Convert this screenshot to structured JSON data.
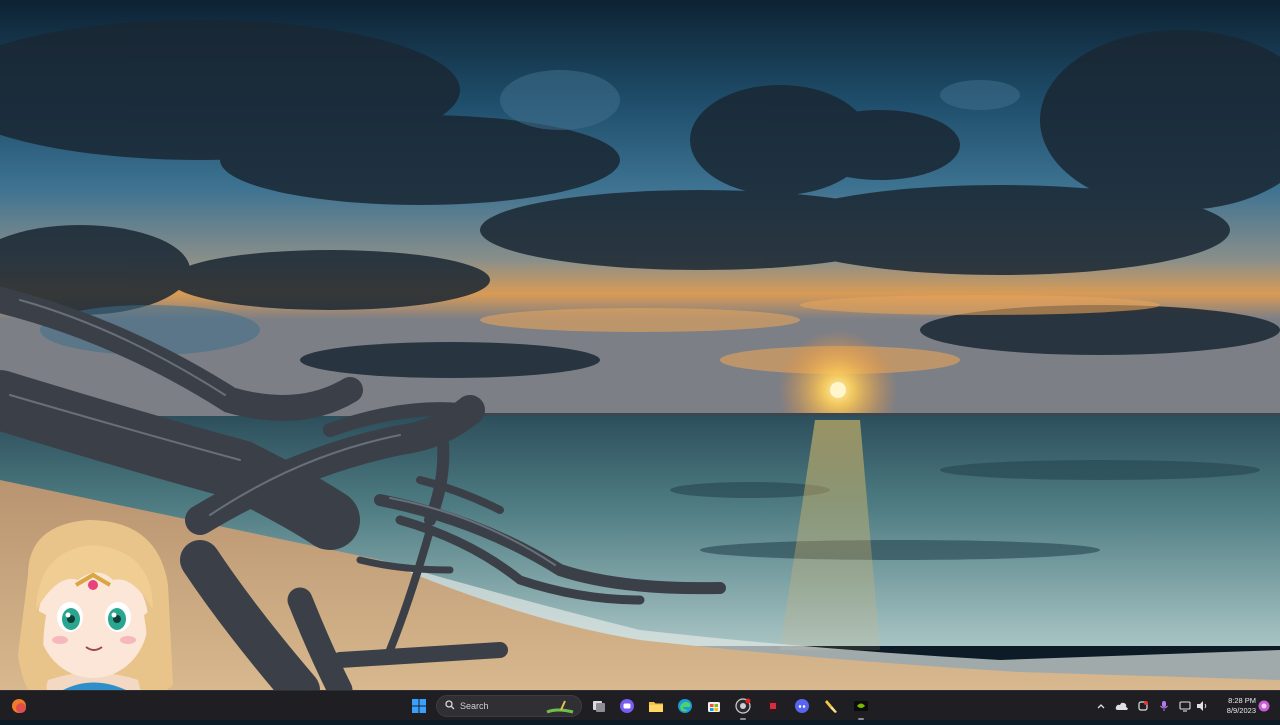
{
  "desktop": {
    "wallpaper_icon": "sunset-beach-driftwood-wallpaper",
    "colors": {
      "sky_top": "#0f2a3d",
      "sky_mid": "#2f6f90",
      "horizon": "#f0a64a",
      "sun": "#ffd36a",
      "sea": "#3d6b74",
      "sand": "#c9a57a",
      "wood": "#3b4048"
    }
  },
  "overlay": {
    "avatar_icon": "anime-girl-avatar"
  },
  "taskbar": {
    "background": "#1f1f23",
    "widget_icon": "weather-widget-icon",
    "search": {
      "label": "Search",
      "icon": "search-icon"
    },
    "apps": [
      {
        "name": "start",
        "icon": "windows-start-icon"
      },
      {
        "name": "task-view",
        "icon": "task-view-icon"
      },
      {
        "name": "chat",
        "icon": "chat-icon"
      },
      {
        "name": "file-explorer",
        "icon": "folder-icon"
      },
      {
        "name": "edge",
        "icon": "edge-browser-icon"
      },
      {
        "name": "store",
        "icon": "store-icon"
      },
      {
        "name": "chrome",
        "icon": "chrome-icon"
      },
      {
        "name": "app-red",
        "icon": "app-icon"
      },
      {
        "name": "discord",
        "icon": "discord-icon"
      },
      {
        "name": "paint",
        "icon": "paint-icon"
      },
      {
        "name": "nvidia",
        "icon": "nvidia-icon"
      }
    ],
    "tray": {
      "icons": [
        "chevron-up-icon",
        "cloud-icon",
        "sync-icon",
        "microphone-icon",
        "network-icon",
        "volume-icon"
      ],
      "time": "8:28 PM",
      "date": "8/9/2023",
      "notification_icon": "copilot-icon"
    }
  }
}
